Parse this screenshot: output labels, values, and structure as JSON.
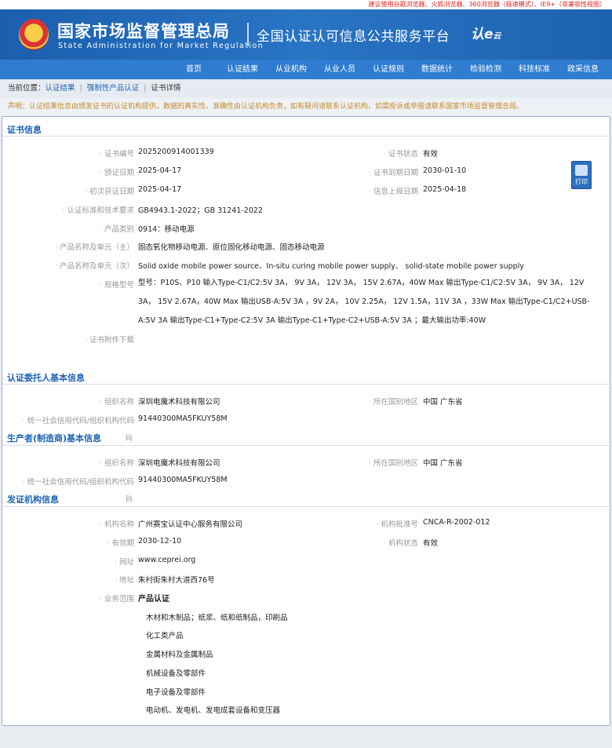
{
  "topbar": {
    "notice": "建议使用谷歌浏览器、火狐浏览器、360浏览器（极速模式）、IE9+（非兼容性视图）"
  },
  "header": {
    "org_cn": "国家市场监督管理总局",
    "org_en": "State Administration  for  Market Regulation",
    "platform": "全国认证认可信息公共服务平台",
    "logo_main": "认e",
    "logo_sub": "云"
  },
  "nav": {
    "items": [
      "首页",
      "认证结果",
      "从业机构",
      "从业人员",
      "认证规则",
      "数据统计",
      "检验检测",
      "科技标准",
      "政采信息"
    ]
  },
  "breadcrumb": {
    "prefix": "当前位置：",
    "items": [
      "认证结果",
      "强制性产品认证",
      "证书详情"
    ]
  },
  "notice": "声明：认证结果信息由颁发证书的认证机构提供，数据的真实性、准确性由认证机构负责，如有疑问请联系认证机构，如需投诉或举报请联系国家市场监督管理总局。",
  "print_label": "打印",
  "cert": {
    "title": "证书信息",
    "fields": {
      "cert_no": {
        "label": "证书编号",
        "value": "2025200914001339"
      },
      "status": {
        "label": "证书状态",
        "value": "有效"
      },
      "issue_date": {
        "label": "颁证日期",
        "value": "2025-04-17"
      },
      "expire_date": {
        "label": "证书到期日期",
        "value": "2030-01-10"
      },
      "first_date": {
        "label": "初次获证日期",
        "value": "2025-04-17"
      },
      "report_date": {
        "label": "信息上报日期",
        "value": "2025-04-18"
      },
      "standard": {
        "label": "认证标准和技术要求",
        "value": "GB4943.1-2022；GB 31241-2022"
      },
      "category": {
        "label": "产品类别",
        "value": "0914：移动电源"
      },
      "name_main": {
        "label": "产品名称及单元（主）",
        "value": "固态氧化物移动电源、原位固化移动电源、固态移动电源"
      },
      "name_sub": {
        "label": "产品名称及单元（次）",
        "value": "Solid oxide mobile power source、In-situ curing mobile power supply、 solid-state mobile power supply"
      },
      "model": {
        "label": "规格型号",
        "value": "型号：P10S、P10 输入Type-C1/C2:5V 3A， 9V 3A， 12V 3A， 15V 2.67A，40W Max 输出Type-C1/C2:5V 3A， 9V 3A， 12V 3A， 15V 2.67A，40W Max 输出USB-A:5V 3A ，9V 2A， 10V 2.25A， 12V 1.5A，11V 3A ，33W Max 输出Type-C1/C2+USB-A:5V 3A 输出Type-C1+Type-C2:5V 3A 输出Type-C1+Type-C2+USB-A:5V 3A ；最大输出功率:40W"
      },
      "attachment": {
        "label": "证书附件下载",
        "value": ""
      }
    }
  },
  "client": {
    "title": "认证委托人基本信息",
    "org_name": {
      "label": "组织名称",
      "value": "深圳电魔术科技有限公司"
    },
    "region": {
      "label": "所在国别地区",
      "value": "中国 广东省"
    },
    "credit_code": {
      "label": "统一社会信用代码/组织机构代码",
      "value": "91440300MA5FKUY58M"
    }
  },
  "manufacturer": {
    "title": "生产者(制造商)基本信息",
    "title_suffix": "码",
    "org_name": {
      "label": "组织名称",
      "value": "深圳电魔术科技有限公司"
    },
    "region": {
      "label": "所在国别地区",
      "value": "中国 广东省"
    },
    "credit_code": {
      "label": "统一社会信用代码/组织机构代码",
      "value": "91440300MA5FKUY58M"
    }
  },
  "issuer": {
    "title": "发证机构信息",
    "title_suffix": "码",
    "org_name": {
      "label": "机构名称",
      "value": "广州赛宝认证中心服务有限公司"
    },
    "approval_no": {
      "label": "机构批准号",
      "value": "CNCA-R-2002-012"
    },
    "valid_until": {
      "label": "有效期",
      "value": "2030-12-10"
    },
    "org_status": {
      "label": "机构状态",
      "value": "有效"
    },
    "website": {
      "label": "网址",
      "value": "www.ceprei.org"
    },
    "address": {
      "label": "地址",
      "value": "朱村街朱村大道西76号"
    },
    "scope": {
      "label": "业务范围",
      "heading": "产品认证",
      "items": [
        "木材和木制品；纸浆、纸和纸制品，印刷品",
        "化工类产品",
        "金属材料及金属制品",
        "机械设备及零部件",
        "电子设备及零部件",
        "电动机、发电机、发电成套设备和变压器"
      ]
    }
  }
}
